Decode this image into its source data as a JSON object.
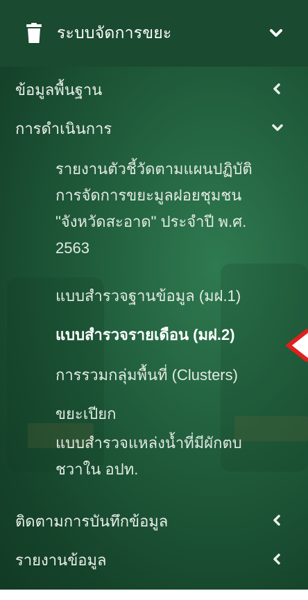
{
  "menu": {
    "header": {
      "title": "ระบบจัดการขยะ",
      "icon": "trash-icon",
      "expanded_icon": "chevron-down-icon"
    },
    "sections": [
      {
        "label": "ข้อมูลพื้นฐาน",
        "state_icon": "chevron-left-icon"
      },
      {
        "label": "การดำเนินการ",
        "state_icon": "chevron-down-icon",
        "children": [
          {
            "line1": "รายงานตัวชี้วัดตามแผนปฏิบัติ",
            "line2": "การจัดการขยะมูลฝอยชุมชน",
            "line3": "\"จังหวัดสะอาด\" ประจำปี พ.ศ.",
            "line4": "2563"
          },
          {
            "line1": "แบบสำรวจฐานข้อมูล (มฝ.1)"
          },
          {
            "line1": "แบบสำรวจรายเดือน (มฝ.2)",
            "active": true
          },
          {
            "line1": "การรวมกลุ่มพื้นที่ (Clusters)"
          },
          {
            "line1": "ขยะเปียก"
          },
          {
            "line1": "แบบสำรวจแหล่งน้ำที่มีผักตบ",
            "line2": "ชวาใน อปท."
          }
        ]
      },
      {
        "label": "ติดตามการบันทึกข้อมูล",
        "state_icon": "chevron-left-icon"
      },
      {
        "label": "รายงานข้อมูล",
        "state_icon": "chevron-left-icon"
      }
    ]
  },
  "colors": {
    "sidebar_bg": "#1f5a3a",
    "header_bg": "#1a4a30",
    "text": "#e9efe9",
    "active_text": "#ffffff",
    "annotation": "#e0201c"
  }
}
